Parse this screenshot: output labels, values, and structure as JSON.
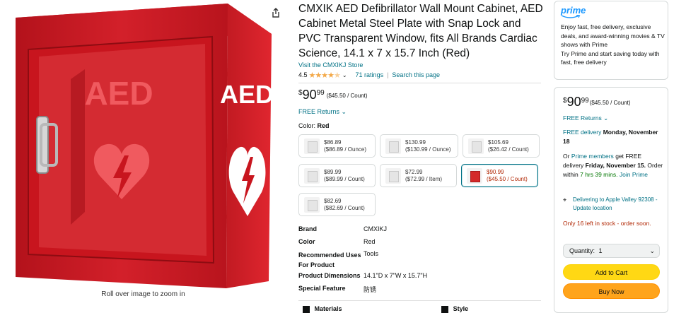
{
  "product": {
    "title": "CMXIK AED Defibrillator Wall Mount Cabinet, AED Cabinet Metal Steel Plate with Snap Lock and PVC Transparent Window, fits All Brands Cardiac Science, 14.1 x 7 x 15.7 Inch (Red)",
    "store_link": "Visit the CMXIKJ Store",
    "rating": "4.5",
    "ratings_count": "71 ratings",
    "search_page": "Search this page",
    "price_currency": "$",
    "price_whole": "90",
    "price_fraction": "99",
    "price_unit": "($45.50 / Count)",
    "free_returns": "FREE Returns",
    "color_label": "Color:",
    "color_value": "Red",
    "zoom_hint": "Roll over image to zoom in",
    "image_text_front": "AED",
    "image_text_side": "AED"
  },
  "swatches": [
    {
      "price": "$86.89",
      "unit": "($86.89 / Ounce)",
      "selected": false
    },
    {
      "price": "$130.99",
      "unit": "($130.99 / Ounce)",
      "selected": false
    },
    {
      "price": "$105.69",
      "unit": "($26.42 / Count)",
      "selected": false
    },
    {
      "price": "$89.99",
      "unit": "($89.99 / Count)",
      "selected": false
    },
    {
      "price": "$72.99",
      "unit": "($72.99 / Item)",
      "selected": false
    },
    {
      "price": "$90.99",
      "unit": "($45.50 / Count)",
      "selected": true
    },
    {
      "price": "$82.69",
      "unit": "($82.69 / Count)",
      "selected": false
    }
  ],
  "specs": [
    {
      "key": "Brand",
      "value": "CMXIKJ"
    },
    {
      "key": "Color",
      "value": "Red"
    },
    {
      "key": "Recommended Uses For Product",
      "value": "Tools"
    },
    {
      "key": "Product Dimensions",
      "value": "14.1\"D x 7\"W x 15.7\"H"
    },
    {
      "key": "Special Feature",
      "value": "防锈"
    }
  ],
  "bottom_tabs": [
    "Materials",
    "Style"
  ],
  "prime": {
    "logo": "prime",
    "text": "Enjoy fast, free delivery, exclusive deals, and award-winning movies & TV shows with Prime",
    "try_text": "Try Prime and start saving today with fast, free delivery"
  },
  "buybox": {
    "price_currency": "$",
    "price_whole": "90",
    "price_fraction": "99",
    "price_unit": "($45.50 / Count)",
    "free_returns": "FREE Returns",
    "delivery_free": "FREE delivery",
    "delivery_date": "Monday, November 18",
    "or_prefix": "Or",
    "prime_members": "Prime members",
    "fast_text": "get FREE delivery",
    "fast_date": "Friday, November 15.",
    "order_within": "Order within",
    "countdown": "7 hrs 39 mins.",
    "join_prime": "Join Prime",
    "deliver_to": "Delivering to Apple Valley 92308 - Update location",
    "stock": "Only 16 left in stock - order soon.",
    "qty_label": "Quantity:",
    "qty_value": "1",
    "add_to_cart": "Add to Cart",
    "buy_now": "Buy Now"
  }
}
